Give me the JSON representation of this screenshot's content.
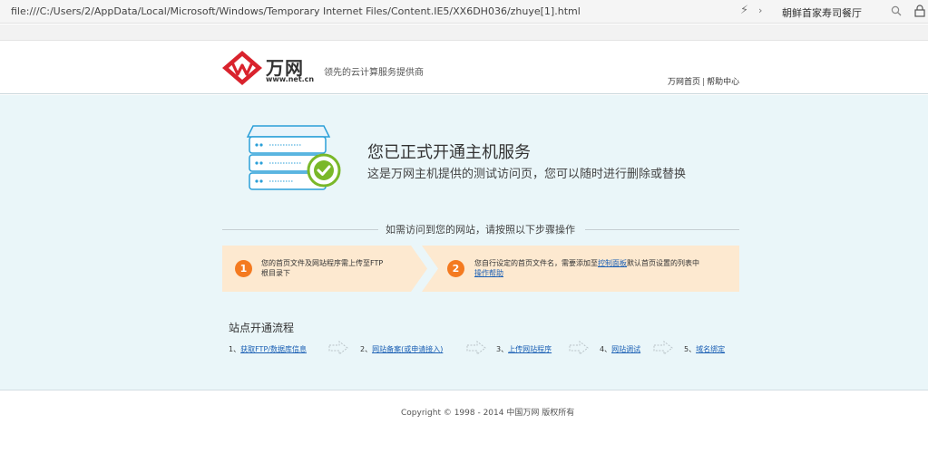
{
  "browser": {
    "url": "file:///C:/Users/2/AppData/Local/Microsoft/Windows/Temporary Internet Files/Content.IE5/XX6DH036/zhuye[1].html",
    "search_text": "朝鲜首家寿司餐厅",
    "icons": [
      "flash-icon",
      "chevron-right-icon",
      "search-icon",
      "lock-icon"
    ]
  },
  "header": {
    "logo_text": "万网",
    "logo_url": "www.net.cn",
    "tagline": "领先的云计算服务提供商",
    "links": [
      "万网首页",
      "帮助中心"
    ],
    "link_separator": "|"
  },
  "main": {
    "title": "您已正式开通主机服务",
    "subtitle": "这是万网主机提供的测试访问页，您可以随时进行删除或替换",
    "divider_text": "如需访问到您的网站，请按照以下步骤操作",
    "steps": [
      {
        "num": "1",
        "text_line1": "您的首页文件及网站程序需上传至FTP",
        "text_line2": "根目录下"
      },
      {
        "num": "2",
        "text_prefix": "您自行设定的首页文件名，需要添加至",
        "link1": "控制面板",
        "text_suffix": "默认首页设置的列表中",
        "link2": "操作帮助"
      }
    ],
    "flow_title": "站点开通流程",
    "flow": [
      {
        "num": "1、",
        "label": "获取FTP/数据库信息"
      },
      {
        "num": "2、",
        "label": "网站备案(或申请接入)"
      },
      {
        "num": "3、",
        "label": "上传网站程序"
      },
      {
        "num": "4、",
        "label": "网站调试"
      },
      {
        "num": "5、",
        "label": "域名绑定"
      }
    ]
  },
  "footer": {
    "copyright": "Copyright © 1998 - 2014 中国万网 版权所有"
  },
  "colors": {
    "main_bg": "#eaf6f9",
    "steps_bg": "#fde9d0",
    "step_number": "#f47a20",
    "link": "#1a5fb4",
    "logo_red": "#d9232d",
    "check_green": "#7ab829"
  }
}
